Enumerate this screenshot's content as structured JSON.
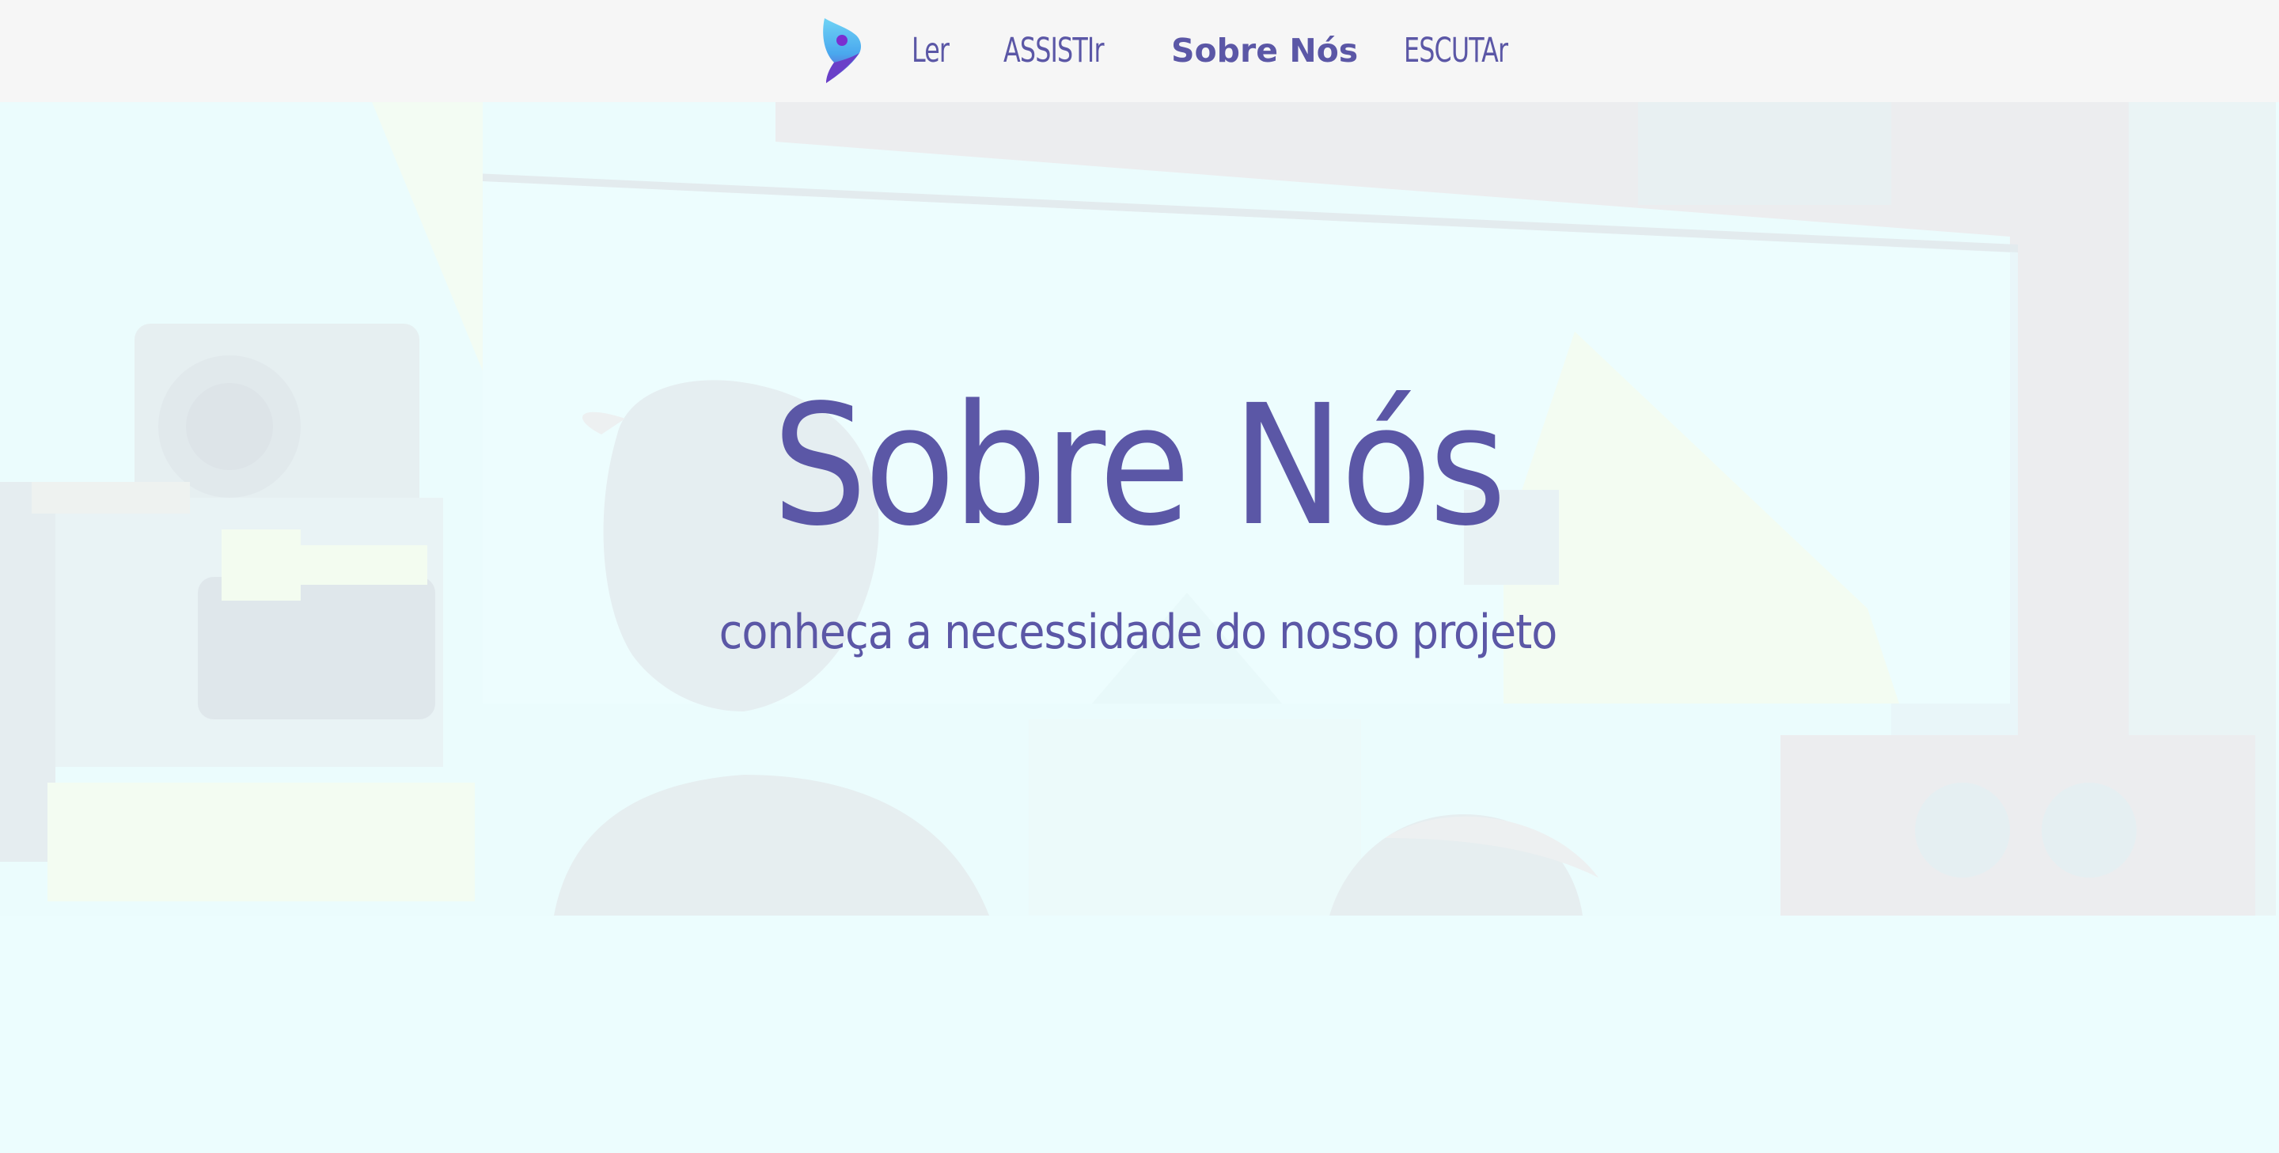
{
  "nav": {
    "logo": "brand-logo",
    "items": [
      {
        "label": "Ler",
        "active": false
      },
      {
        "label": "ASSISTIr",
        "active": false
      },
      {
        "label": "Sobre Nós",
        "active": true
      },
      {
        "label": "ESCUTAr",
        "active": false
      }
    ]
  },
  "hero": {
    "title": "Sobre Nós",
    "subtitle": "conheça a necessidade do nosso projeto",
    "background": "illustrated-cinema-scene-image"
  },
  "colors": {
    "accent": "#5b57a6",
    "nav_background": "#f6f6f6",
    "page_background": "#ecfdfe",
    "logo_cyan": "#5ac8f0",
    "logo_purple": "#6a3fc8"
  }
}
